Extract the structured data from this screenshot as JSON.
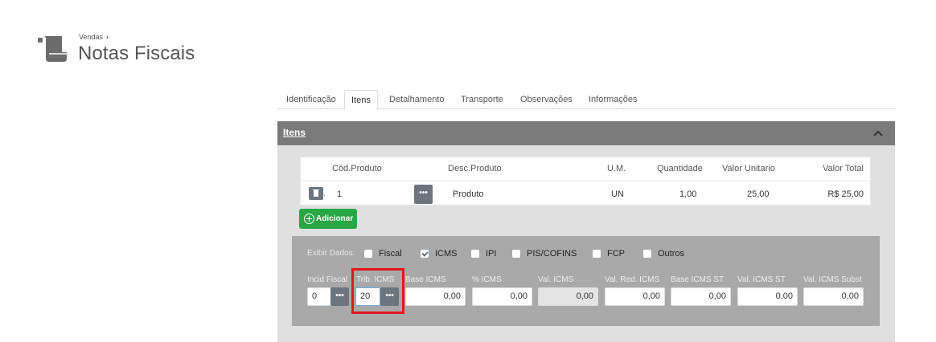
{
  "header": {
    "breadcrumb": "Vendas",
    "breadcrumb_sep": "›",
    "title": "Notas Fiscais",
    "icon": "scroll-icon"
  },
  "tabs": [
    {
      "label": "Identificação",
      "active": false
    },
    {
      "label": "Itens",
      "active": true
    },
    {
      "label": "Detalhamento",
      "active": false
    },
    {
      "label": "Transporte",
      "active": false
    },
    {
      "label": "Observações",
      "active": false
    },
    {
      "label": "Informações",
      "active": false
    }
  ],
  "panel": {
    "title": "Itens",
    "collapse_icon": "chevron-up-icon"
  },
  "items_table": {
    "headers": {
      "cod": "Cód.Produto",
      "desc": "Desc.Produto",
      "um": "U.M.",
      "qtd": "Quantidade",
      "valor_unit": "Valor Unitario",
      "valor_total": "Valor Total"
    },
    "rows": [
      {
        "cod": "1",
        "desc": "Produto",
        "um": "UN",
        "qtd": "1,00",
        "valor_unit": "25,00",
        "valor_total": "R$ 25,00"
      }
    ],
    "ellipsis": "•••"
  },
  "add_button": {
    "label": "Adicionar"
  },
  "detail": {
    "exibir_label": "Exibir Dados:",
    "checkboxes": [
      {
        "label": "Fiscal",
        "checked": false
      },
      {
        "label": "ICMS",
        "checked": true
      },
      {
        "label": "IPI",
        "checked": false
      },
      {
        "label": "PIS/COFINS",
        "checked": false
      },
      {
        "label": "FCP",
        "checked": false
      },
      {
        "label": "Outros",
        "checked": false
      }
    ],
    "fields": {
      "incid_fiscal": {
        "label": "Incid Fiscal",
        "value": "0"
      },
      "trib_icms": {
        "label": "Trib. ICMS",
        "value": "20"
      },
      "base_icms": {
        "label": "Base ICMS",
        "value": "0,00"
      },
      "pct_icms": {
        "label": "% ICMS",
        "value": "0,00"
      },
      "val_icms": {
        "label": "Val. ICMS",
        "value": "0,00"
      },
      "val_red_icms": {
        "label": "Val. Red. ICMS",
        "value": "0,00"
      },
      "base_icms_st": {
        "label": "Base ICMS ST",
        "value": "0,00"
      },
      "val_icms_st": {
        "label": "Val. ICMS ST",
        "value": "0,00"
      },
      "val_icms_subst": {
        "label": "Val. ICMS Subst",
        "value": "0,00"
      }
    },
    "ellipsis": "•••"
  },
  "colors": {
    "panel_header": "#7a7a7a",
    "panel_body": "#e0e0e0",
    "detail_bg": "#a9a9a9",
    "add_button": "#28a745",
    "highlight": "#e0191f"
  }
}
